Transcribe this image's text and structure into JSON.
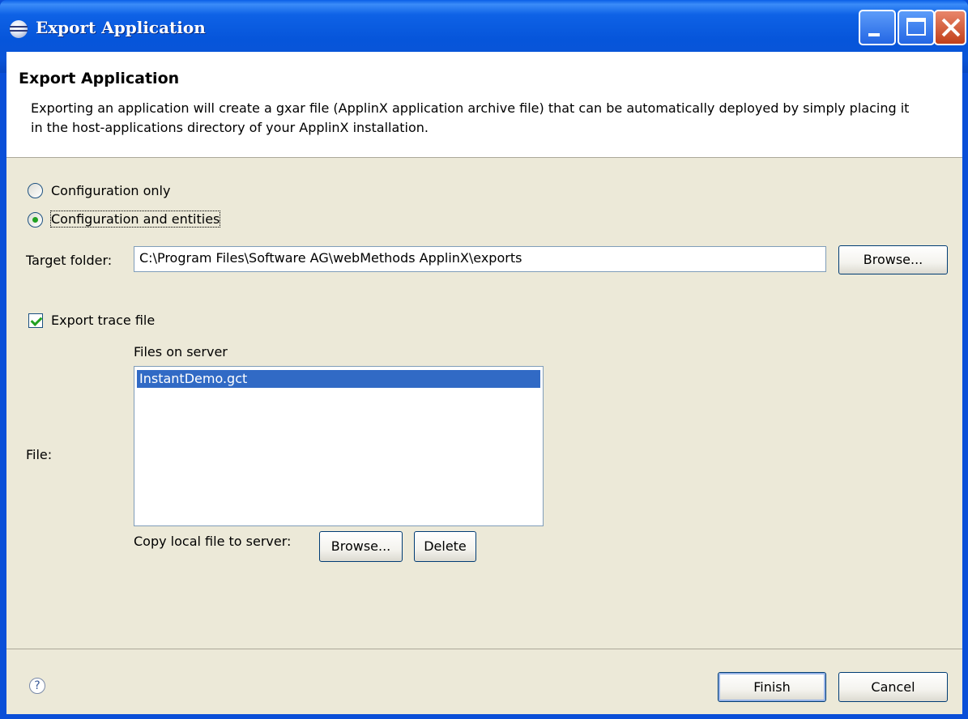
{
  "window": {
    "title": "Export Application"
  },
  "header": {
    "title": "Export Application",
    "description": "Exporting an application will create a gxar file (ApplinX application archive file) that can be automatically deployed by simply placing it in the host-applications directory of your ApplinX installation."
  },
  "options": {
    "config_only_label": "Configuration only",
    "config_entities_label": "Configuration and entities",
    "selected": "Configuration and entities"
  },
  "target": {
    "label": "Target folder:",
    "value": "C:\\Program Files\\Software AG\\webMethods ApplinX\\exports",
    "browse_label": "Browse..."
  },
  "trace": {
    "checkbox_label": "Export trace file",
    "checked": true,
    "files_header": "Files on server",
    "file_label": "File:",
    "files": [
      "InstantDemo.gct"
    ],
    "copy_label": "Copy local file to server:",
    "browse_label": "Browse...",
    "delete_label": "Delete"
  },
  "footer": {
    "help_icon": "help-icon",
    "finish_label": "Finish",
    "cancel_label": "Cancel"
  },
  "colors": {
    "titlebar": "#0a55d8",
    "dialog_bg": "#ece9d8",
    "selection": "#316ac5"
  }
}
